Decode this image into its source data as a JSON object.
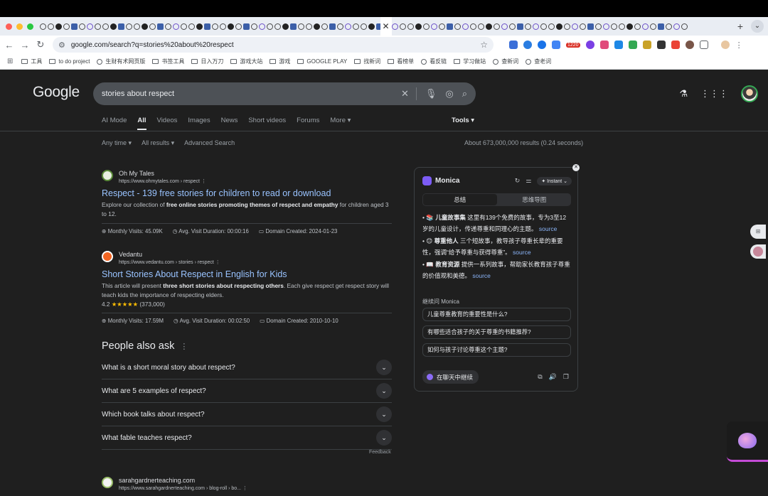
{
  "browser": {
    "url": "google.com/search?q=stories%20about%20respect",
    "bookmarks": [
      "工具",
      "to do project",
      "生财有术网页版",
      "书签工具",
      "日入万刀",
      "游戏大站",
      "游戏",
      "GOOGLE PLAY",
      "找新词",
      "看榜单",
      "看反链",
      "学习做站",
      "查新词",
      "查老词"
    ],
    "ext_badge": "1220"
  },
  "google": {
    "logo": "Google",
    "query": "stories about respect",
    "tabs": [
      "AI Mode",
      "All",
      "Videos",
      "Images",
      "News",
      "Short videos",
      "Forums",
      "More"
    ],
    "tools": "Tools",
    "filters": [
      "Any time",
      "All results",
      "Advanced Search"
    ],
    "result_stats": "About 673,000,000 results (0.24 seconds)"
  },
  "results": [
    {
      "site": "Oh My Tales",
      "url": "https://www.ohmytales.com › respect",
      "title": "Respect - 139 free stories for children to read or download",
      "desc_pre": "Explore our collection of ",
      "desc_bold": "free online stories promoting themes of respect and empathy",
      "desc_post": " for children aged 3 to 12.",
      "meta": [
        "Monthly Visits: 45.09K",
        "Avg. Visit Duration: 00:00:16",
        "Domain Created: 2024-01-23"
      ]
    },
    {
      "site": "Vedantu",
      "url": "https://www.vedantu.com › stories › respect",
      "title": "Short Stories About Respect in English for Kids",
      "desc_pre": "This article will present ",
      "desc_bold": "three short stories about respecting others",
      "desc_post": ". Each give respect get respect story will teach kids the importance of respecting elders.",
      "rating": "4.2",
      "stars": "★★★★★",
      "reviews": "(373,000)",
      "meta": [
        "Monthly Visits: 17.59M",
        "Avg. Visit Duration: 00:02:50",
        "Domain Created: 2010-10-10"
      ]
    },
    {
      "site": "sarahgardnerteaching.com",
      "url": "https://www.sarahgardnerteaching.com › blog-roll › bo..."
    }
  ],
  "paa": {
    "title": "People also ask",
    "questions": [
      "What is a short moral story about respect?",
      "What are 5 examples of respect?",
      "Which book talks about respect?",
      "What fable teaches respect?"
    ],
    "feedback": "Feedback"
  },
  "monica": {
    "name": "Monica",
    "mode": "Instant",
    "seg_summary": "总结",
    "seg_mindmap": "思维导图",
    "bullets": [
      {
        "title": "儿童故事集",
        "text": " 这里有139个免费的故事，专为3至12岁的儿童设计，传递尊重和同理心的主题。",
        "src": "source"
      },
      {
        "title": "尊重他人",
        "text": " 三个短故事，教导孩子尊重长辈的重要性，强调“给予尊重与获得尊重”。",
        "src": "source"
      },
      {
        "title": "教育资源",
        "text": " 提供一系列故事，帮助家长教育孩子尊重的价值观和美德。",
        "src": "source"
      }
    ],
    "follow_label": "继续问 Monica",
    "follow_questions": [
      "儿童尊重教育的重要性是什么?",
      "有哪些适合孩子的关于尊重的书籍推荐?",
      "如何与孩子讨论尊重这个主题?"
    ],
    "chat_button": "在聊天中继续"
  }
}
